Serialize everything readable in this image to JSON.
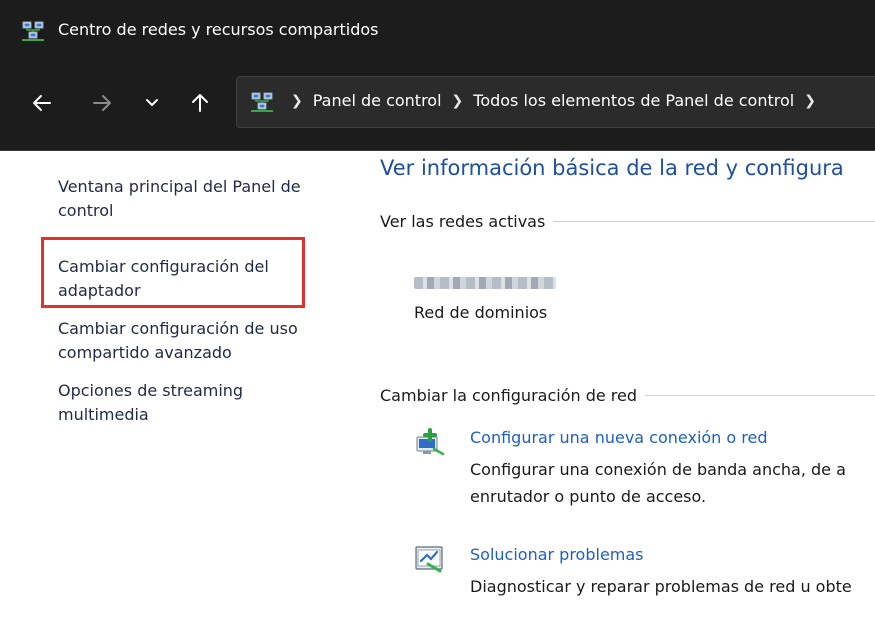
{
  "window": {
    "title": "Centro de redes y recursos compartidos"
  },
  "navigation": {
    "back_icon": "arrow-left-icon",
    "forward_icon": "arrow-right-icon",
    "recent_icon": "chevron-down-icon",
    "up_icon": "arrow-up-icon"
  },
  "address_bar": {
    "crumbs": [
      "Panel de control",
      "Todos los elementos de Panel de control"
    ]
  },
  "sidebar": {
    "items": [
      {
        "label": "Ventana principal del Panel de control"
      },
      {
        "label": "Cambiar configuración del adaptador"
      },
      {
        "label": "Cambiar configuración de uso compartido avanzado"
      },
      {
        "label": "Opciones de streaming multimedia"
      }
    ],
    "highlight_color": "#e3312b"
  },
  "main": {
    "title": "Ver información básica de la red y configura",
    "active_networks_heading": "Ver las redes activas",
    "network": {
      "type": "Red de dominios"
    },
    "change_settings_heading": "Cambiar la configuración de red",
    "tasks": [
      {
        "icon": "new-connection-icon",
        "link": "Configurar una nueva conexión o red",
        "description_line1": "Configurar una conexión de banda ancha, de a",
        "description_line2": "enrutador o punto de acceso."
      },
      {
        "icon": "troubleshoot-icon",
        "link": "Solucionar problemas",
        "description_line1": "Diagnosticar y reparar problemas de red u obte"
      }
    ]
  },
  "colors": {
    "titlebar_bg": "#1c1c1c",
    "link_blue": "#1e5fc4",
    "title_blue": "#1e4fa0"
  }
}
